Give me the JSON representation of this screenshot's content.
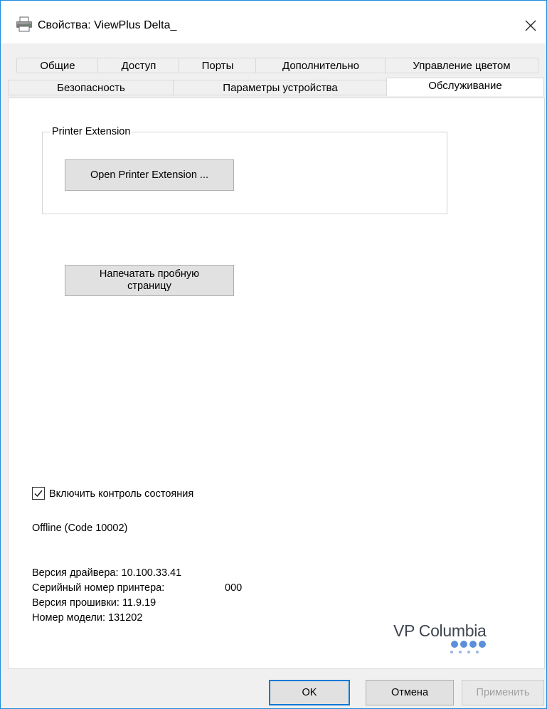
{
  "window": {
    "title": "Свойства: ViewPlus Delta_",
    "close_glyph": "✕"
  },
  "tabs": {
    "row1": [
      "Общие",
      "Доступ",
      "Порты",
      "Дополнительно",
      "Управление цветом"
    ],
    "row2": [
      "Безопасность",
      "Параметры устройства",
      "Обслуживание"
    ],
    "active": "Обслуживание"
  },
  "printer_extension": {
    "group_label": "Printer Extension",
    "open_button": "Open Printer Extension ..."
  },
  "test_page": {
    "line1": "Напечатать пробную",
    "line2": "страницу"
  },
  "status_monitor": {
    "label": "Включить контроль состояния",
    "checked": true
  },
  "status_text": "Offline (Code 10002)",
  "info": {
    "driver_version": "Версия драйвера: 10.100.33.41",
    "serial_label": "Серийный номер принтера:",
    "serial_value": "000",
    "firmware": "Версия прошивки: 11.9.19",
    "model": "Номер модели: 131202"
  },
  "logo": {
    "text": "VP Columbia",
    "dot_color": "#5b8fd9"
  },
  "dialog_buttons": {
    "ok": "OK",
    "cancel": "Отмена",
    "apply": "Применить"
  },
  "colors": {
    "window_border": "#1c8ad8",
    "default_button_border": "#0078d7"
  },
  "icons": [
    "printer-icon",
    "close-icon",
    "checkmark-icon",
    "vp-columbia-logo"
  ]
}
